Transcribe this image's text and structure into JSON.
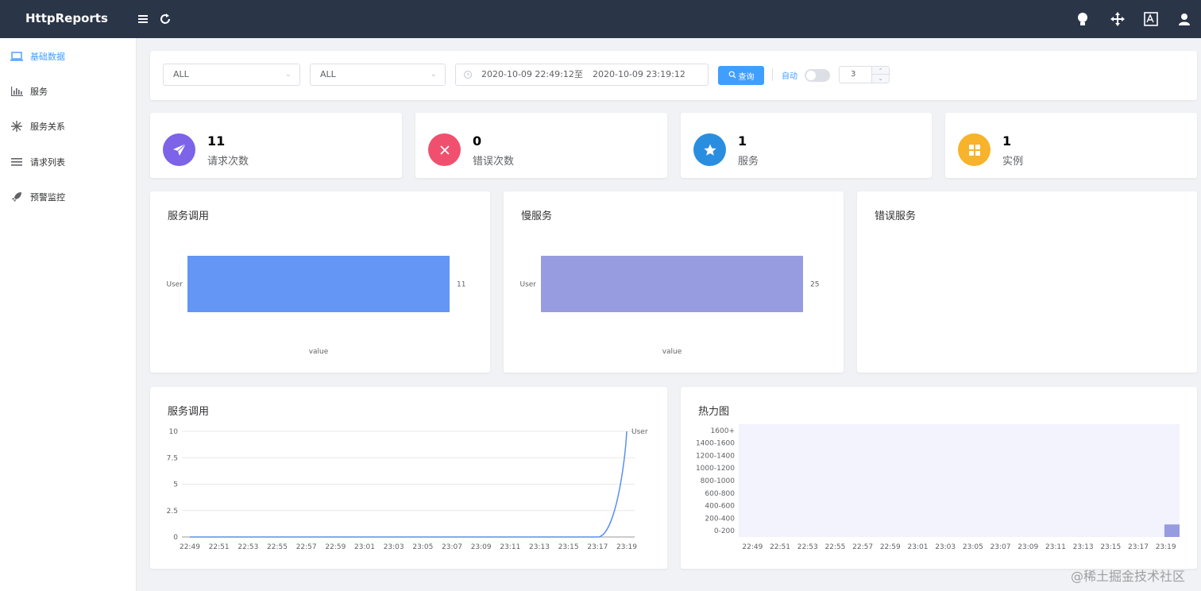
{
  "header": {
    "brand": "HttpReports",
    "icons": [
      "menu-icon",
      "refresh-icon",
      "bulb-icon",
      "move-icon",
      "language-icon",
      "user-icon"
    ]
  },
  "sidebar": {
    "items": [
      {
        "label": "基础数据",
        "icon": "laptop-icon",
        "active": true
      },
      {
        "label": "服务",
        "icon": "bar-chart-icon",
        "active": false
      },
      {
        "label": "服务关系",
        "icon": "snowflake-icon",
        "active": false
      },
      {
        "label": "请求列表",
        "icon": "list-icon",
        "active": false
      },
      {
        "label": "预警监控",
        "icon": "rocket-icon",
        "active": false
      }
    ]
  },
  "filters": {
    "service_select": "ALL",
    "instance_select": "ALL",
    "date_start": "2020-10-09 22:49:12",
    "date_sep": "至",
    "date_end": "2020-10-09 23:19:12",
    "query_label": "查询",
    "auto_label": "自动",
    "auto_on": false,
    "interval_value": "3"
  },
  "stats": [
    {
      "value": "11",
      "label": "请求次数",
      "color": "#7c63e8",
      "icon": "paper-plane-icon"
    },
    {
      "value": "0",
      "label": "错误次数",
      "color": "#f0506e",
      "icon": "close-icon"
    },
    {
      "value": "1",
      "label": "服务",
      "color": "#2a8ee0",
      "icon": "star-icon"
    },
    {
      "value": "1",
      "label": "实例",
      "color": "#f7b32b",
      "icon": "grid-icon"
    }
  ],
  "panels": {
    "service_calls_title": "服务调用",
    "slow_services_title": "慢服务",
    "error_services_title": "错误服务",
    "trend_title": "服务调用",
    "heatmap_title": "热力图"
  },
  "watermark": "@稀土掘金技术社区",
  "chart_data": [
    {
      "type": "bar",
      "orientation": "horizontal",
      "title": "服务调用",
      "categories": [
        "User"
      ],
      "values": [
        11
      ],
      "xlabel": "value",
      "color": "#6396f5"
    },
    {
      "type": "bar",
      "orientation": "horizontal",
      "title": "慢服务",
      "categories": [
        "User"
      ],
      "values": [
        25
      ],
      "xlabel": "value",
      "color": "#979ce0"
    },
    {
      "type": "line",
      "title": "服务调用",
      "x": [
        "22:49",
        "22:51",
        "22:53",
        "22:55",
        "22:57",
        "22:59",
        "23:01",
        "23:03",
        "23:05",
        "23:07",
        "23:09",
        "23:11",
        "23:13",
        "23:15",
        "23:17",
        "23:19"
      ],
      "series": [
        {
          "name": "User",
          "values": [
            0,
            0,
            0,
            0,
            0,
            0,
            0,
            0,
            0,
            0,
            0,
            0,
            0,
            0,
            0,
            10
          ]
        }
      ],
      "yticks": [
        "0",
        "2.5",
        "5",
        "7.5",
        "10"
      ],
      "ylim": [
        0,
        10
      ],
      "color": "#5b8ff0"
    },
    {
      "type": "heatmap",
      "title": "热力图",
      "x": [
        "22:49",
        "22:51",
        "22:53",
        "22:55",
        "22:57",
        "22:59",
        "23:01",
        "23:03",
        "23:05",
        "23:07",
        "23:09",
        "23:11",
        "23:13",
        "23:15",
        "23:17",
        "23:19"
      ],
      "y": [
        "0-200",
        "200-400",
        "400-600",
        "600-800",
        "800-1000",
        "1000-1200",
        "1200-1400",
        "1400-1600",
        "1600+"
      ],
      "cells": [
        {
          "x": "23:19",
          "y": "0-200",
          "value": 1
        }
      ],
      "color_low": "#f2f3fd",
      "color_high": "#979ce0"
    }
  ]
}
